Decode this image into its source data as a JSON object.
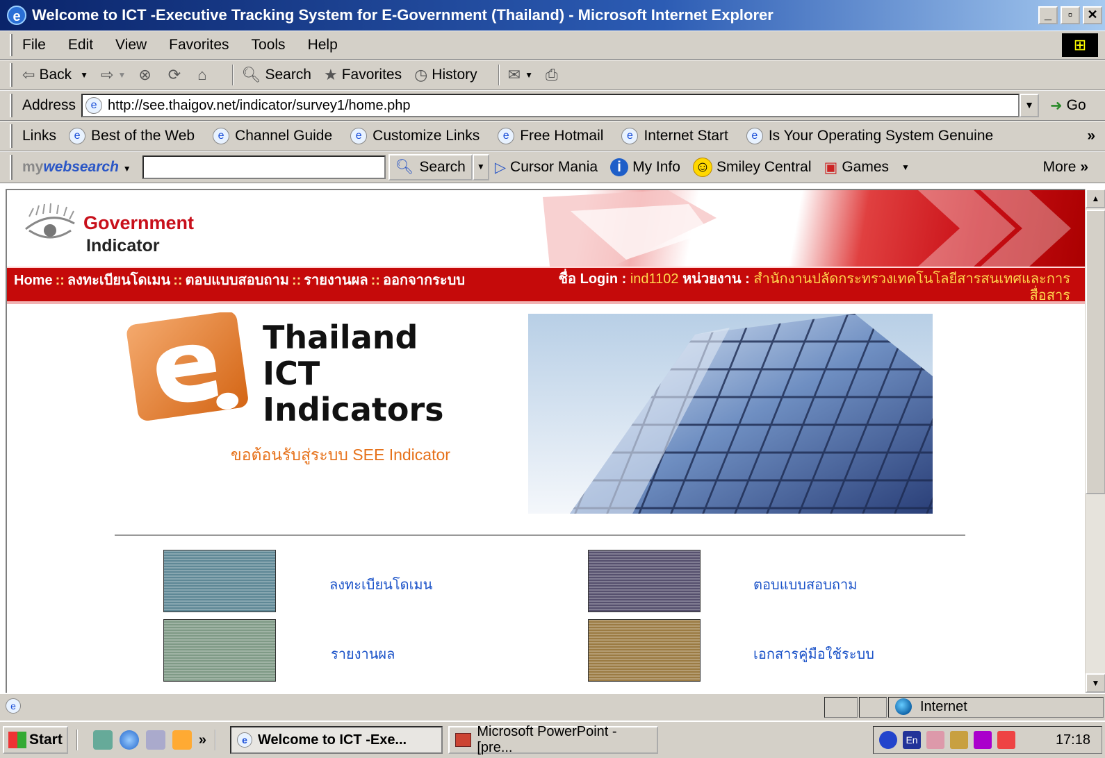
{
  "window": {
    "title": "Welcome to ICT -Executive Tracking System for E-Government (Thailand) - Microsoft Internet Explorer",
    "controls": [
      "_",
      "▫",
      "✕"
    ]
  },
  "menu": [
    "File",
    "Edit",
    "View",
    "Favorites",
    "Tools",
    "Help"
  ],
  "toolbar": {
    "back": "Back",
    "search": "Search",
    "favorites": "Favorites",
    "history": "History"
  },
  "address": {
    "label": "Address",
    "url": "http://see.thaigov.net/indicator/survey1/home.php",
    "go": "Go"
  },
  "links": {
    "label": "Links",
    "items": [
      "Best of the Web",
      "Channel Guide",
      "Customize Links",
      "Free Hotmail",
      "Internet Start",
      "Is Your Operating System Genuine"
    ],
    "overflow": "»"
  },
  "websearch": {
    "brand_prefix": "my",
    "brand_main": "websearch",
    "search_label": "Search",
    "items": [
      "Cursor Mania",
      "My Info",
      "Smiley Central",
      "Games"
    ],
    "more": "More"
  },
  "site": {
    "brand_line1": "Government",
    "brand_line2": "Indicator",
    "nav": [
      "Home",
      "ลงทะเบียนโดเมน",
      "ตอบแบบสอบถาม",
      "รายงานผล",
      "ออกจากระบบ"
    ],
    "nav_separator": "::",
    "login_label": "ชื่อ Login :",
    "login_value": "ind1102",
    "agency_label": "หน่วยงาน :",
    "agency_value": "สำนักงานปลัดกระทรวงเทคโนโลยีสารสนเทศและการสื่อสาร",
    "title_lines": [
      "Thailand",
      "ICT",
      "Indicators"
    ],
    "welcome": "ขอต้อนรับสู่ระบบ SEE Indicator",
    "tiles": [
      {
        "label": "ลงทะเบียนโดเมน"
      },
      {
        "label": "ตอบแบบสอบถาม"
      },
      {
        "label": "รายงานผล"
      },
      {
        "label": "เอกสารคู่มือใช้ระบบ"
      }
    ]
  },
  "status": {
    "zone": "Internet"
  },
  "taskbar": {
    "start": "Start",
    "tasks": [
      "Welcome to ICT -Exe...",
      "Microsoft PowerPoint - [pre..."
    ],
    "clock": "17:18"
  },
  "colors": {
    "titlebar": "#0a246a",
    "chrome": "#d4d0c8",
    "brand_red": "#c50a0a",
    "link_blue": "#1a52c8",
    "welcome_orange": "#e6711a",
    "login_yellow": "#ffd64d"
  }
}
